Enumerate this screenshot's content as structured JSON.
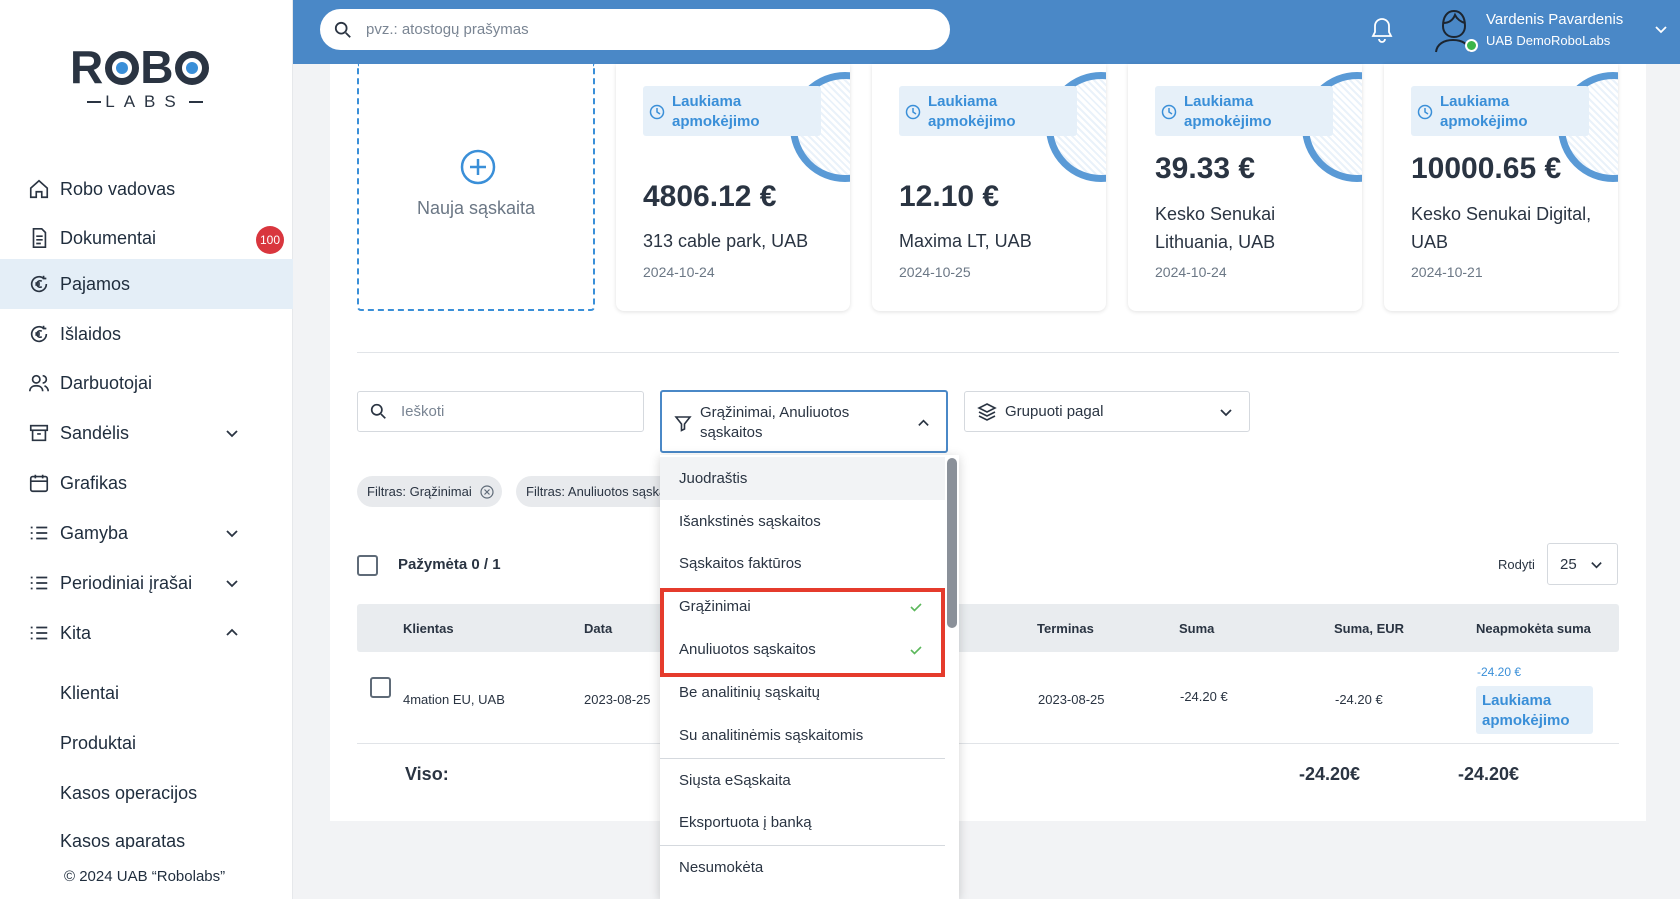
{
  "brand": {
    "logo_top": "ROBO",
    "logo_bottom": "LABS"
  },
  "sidebar": {
    "items": [
      {
        "label": "Robo vadovas"
      },
      {
        "label": "Dokumentai",
        "badge": "100"
      },
      {
        "label": "Pajamos"
      },
      {
        "label": "Išlaidos"
      },
      {
        "label": "Darbuotojai"
      },
      {
        "label": "Sandėlis"
      },
      {
        "label": "Grafikas"
      },
      {
        "label": "Gamyba"
      },
      {
        "label": "Periodiniai įrašai"
      },
      {
        "label": "Kita"
      }
    ],
    "sub_items": [
      {
        "label": "Klientai"
      },
      {
        "label": "Produktai"
      },
      {
        "label": "Kasos operacijos"
      },
      {
        "label": "Kasos aparatas"
      }
    ],
    "copyright": "© 2024 UAB “Robolabs”"
  },
  "header": {
    "search_placeholder": "pvz.: atostogų prašymas",
    "user_name": "Vardenis Pavardenis",
    "user_company": "UAB DemoRoboLabs"
  },
  "new_invoice_label": "Nauja sąskaita",
  "cards": [
    {
      "status": "Laukiama apmokėjimo",
      "amount": "4806.12 €",
      "client": "313 cable park, UAB",
      "date": "2024-10-24"
    },
    {
      "status": "Laukiama apmokėjimo",
      "amount": "12.10 €",
      "client": "Maxima LT, UAB",
      "date": "2024-10-25"
    },
    {
      "status": "Laukiama apmokėjimo",
      "amount": "39.33 €",
      "client": "Kesko Senukai Lithuania, UAB",
      "date": "2024-10-24"
    },
    {
      "status": "Laukiama apmokėjimo",
      "amount": "10000.65 €",
      "client": "Kesko Senukai Digital, UAB",
      "date": "2024-10-21"
    }
  ],
  "toolbar": {
    "search_placeholder": "Ieškoti",
    "filter_value": "Grąžinimai, Anuliuotos sąskaitos",
    "group_placeholder": "Grupuoti pagal"
  },
  "chips": [
    "Filtras: Grąžinimai",
    "Filtras: Anuliuotos sąskaitos"
  ],
  "selection": {
    "label": "Pažymėta 0 / 1",
    "show_label": "Rodyti",
    "page_size": "25"
  },
  "table": {
    "headers": {
      "client": "Klientas",
      "date": "Data",
      "term": "Terminas",
      "sum": "Suma",
      "sum_eur": "Suma, EUR",
      "unpaid": "Neapmokėta suma"
    },
    "rows": [
      {
        "client": "4mation EU, UAB",
        "date": "2023-08-25",
        "term": "2023-08-25",
        "sum": "-24.20 €",
        "sum_eur": "-24.20 €",
        "unpaid": "-24.20 €",
        "status": "Laukiama apmokėjimo"
      }
    ],
    "total_label": "Viso:",
    "total_sum_eur": "-24.20€",
    "total_unpaid": "-24.20€"
  },
  "dropdown": {
    "options": [
      {
        "label": "Juodraštis",
        "checked": false
      },
      {
        "label": "Išankstinės sąskaitos",
        "checked": false
      },
      {
        "label": "Sąskaitos faktūros",
        "checked": false
      },
      {
        "label": "Grąžinimai",
        "checked": true
      },
      {
        "label": "Anuliuotos sąskaitos",
        "checked": true
      },
      {
        "label": "Be analitinių sąskaitų",
        "checked": false
      },
      {
        "label": "Su analitinėmis sąskaitomis",
        "checked": false
      },
      {
        "label": "Siųsta eSąskaita",
        "checked": false
      },
      {
        "label": "Eksportuota į banką",
        "checked": false
      },
      {
        "label": "Nesumokėta",
        "checked": false
      }
    ]
  },
  "colors": {
    "accent": "#4a88c7",
    "link": "#3a8fd8",
    "badge": "#d9363e",
    "highlight": "#e53b2c",
    "check": "#5cb85c"
  }
}
